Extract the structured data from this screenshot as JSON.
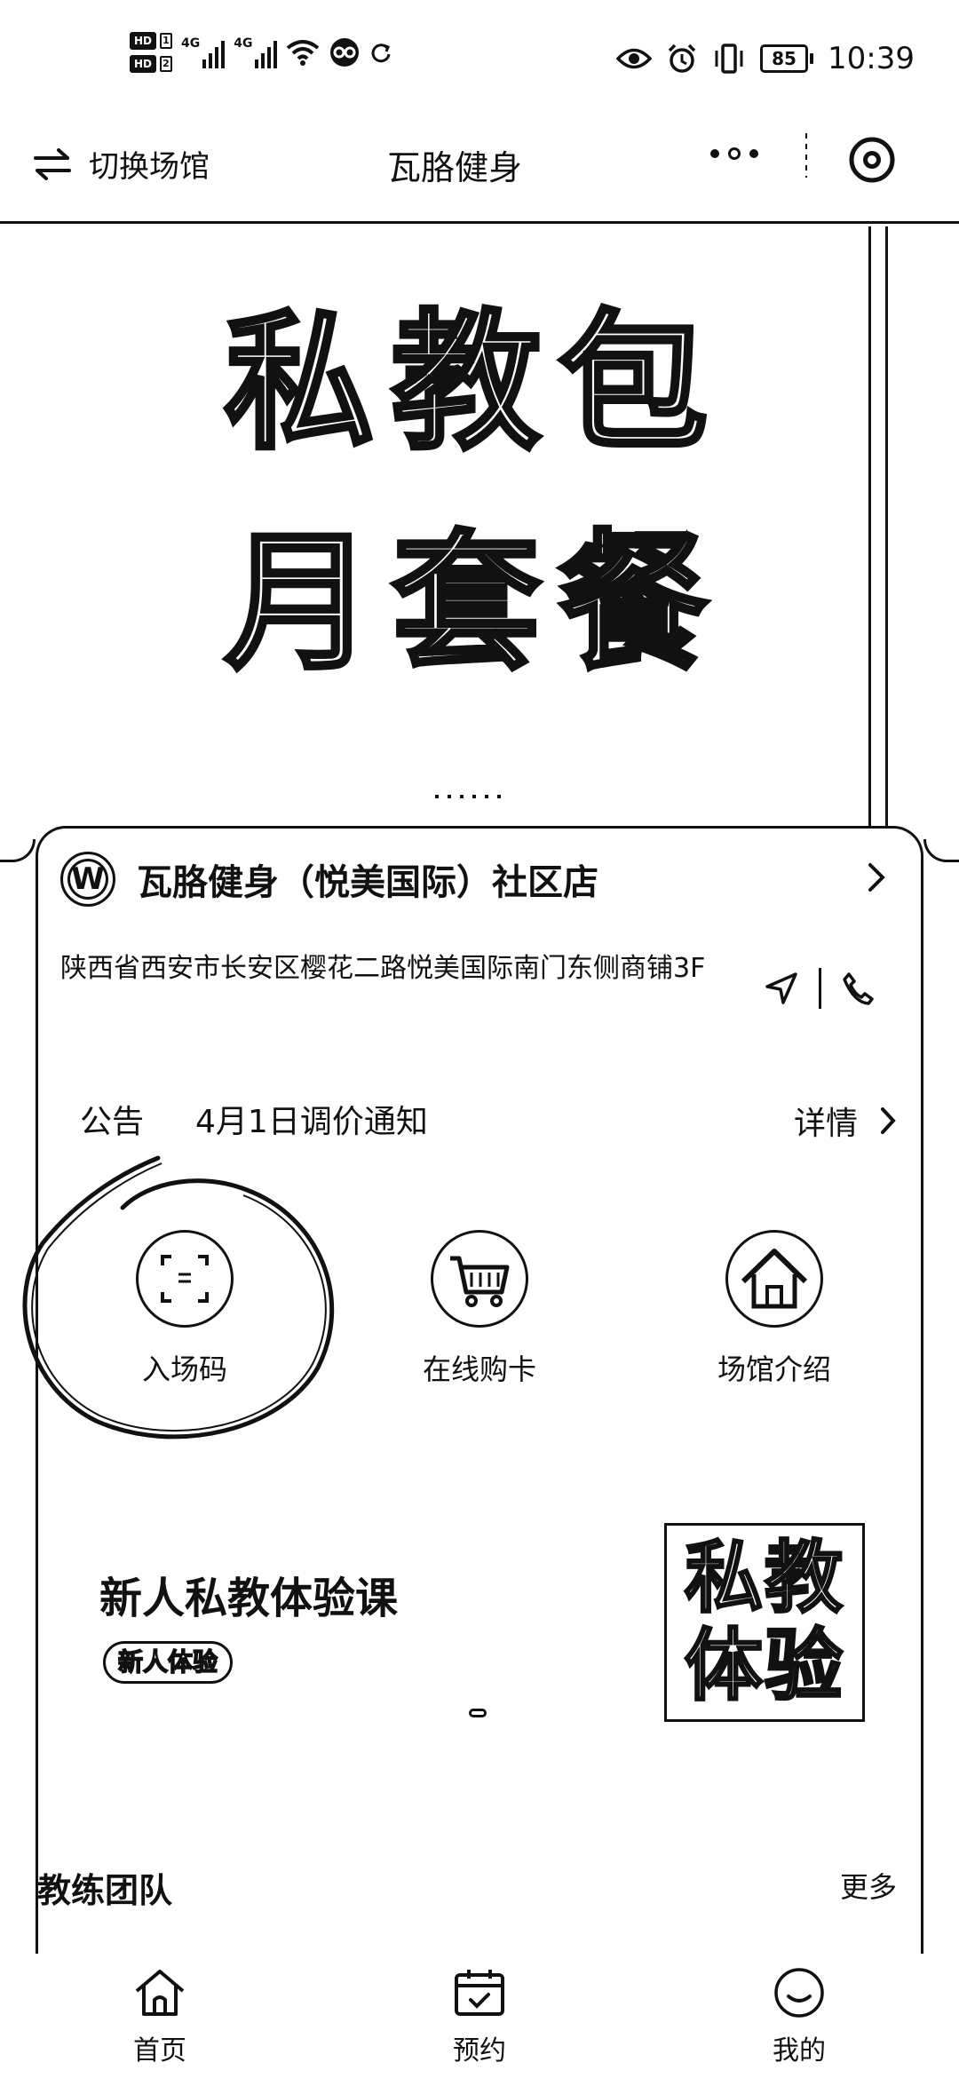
{
  "status_bar": {
    "hd1": "HD",
    "hd1_num": "1",
    "hd2": "HD",
    "hd2_num": "2",
    "net1": "4G",
    "net2": "4G",
    "battery": "85",
    "time": "10:39"
  },
  "header": {
    "switch_label": "切换场馆",
    "title": "瓦胳健身"
  },
  "banner": {
    "line1": "私教包",
    "line2": "月套餐"
  },
  "store": {
    "logo_letter": "W",
    "name": "瓦胳健身（悦美国际）社区店",
    "address": "陕西省西安市长安区樱花二路悦美国际南门东侧商铺3F"
  },
  "notice": {
    "label": "公告",
    "text": "4月1日调价通知",
    "more": "详情"
  },
  "quick_actions": [
    {
      "label": "入场码",
      "icon": "qr-scan-icon"
    },
    {
      "label": "在线购卡",
      "icon": "shopping-cart-icon"
    },
    {
      "label": "场馆介绍",
      "icon": "house-icon"
    }
  ],
  "promo": {
    "title": "新人私教体验课",
    "tag": "新人体验",
    "image_line1": "私教",
    "image_line2": "体验"
  },
  "coaches": {
    "title": "教练团队",
    "more": "更多"
  },
  "tabbar": [
    {
      "label": "首页",
      "icon": "home-icon"
    },
    {
      "label": "预约",
      "icon": "calendar-icon"
    },
    {
      "label": "我的",
      "icon": "profile-icon"
    }
  ]
}
